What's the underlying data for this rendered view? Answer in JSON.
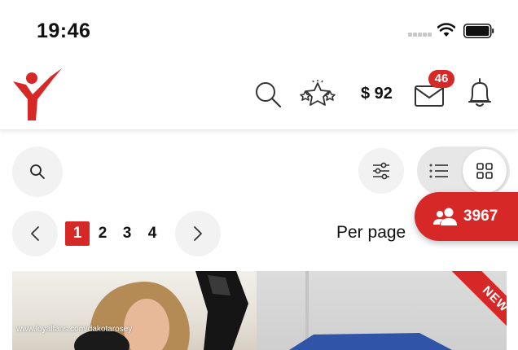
{
  "status_bar": {
    "time": "19:46"
  },
  "header": {
    "logo_icon": "brand-figure-icon",
    "balance": "$ 92",
    "messages_badge": "46",
    "icons": [
      "search-icon",
      "stars-icon",
      "mail-icon",
      "bell-icon"
    ]
  },
  "controls": {
    "search_icon": "search-icon",
    "filter_icon": "sliders-icon",
    "list_view_icon": "list-icon",
    "grid_view_icon": "grid-icon"
  },
  "pagination": {
    "pages": [
      "1",
      "2",
      "3",
      "4"
    ],
    "current_page": "1",
    "per_page_label": "Per page"
  },
  "followers": {
    "count": "3967"
  },
  "post": {
    "watermark": "www.loyalfans.com/dakotarosey",
    "ribbon": "NEW"
  },
  "colors": {
    "accent": "#d72828",
    "button_bg": "#f2f2f2"
  }
}
